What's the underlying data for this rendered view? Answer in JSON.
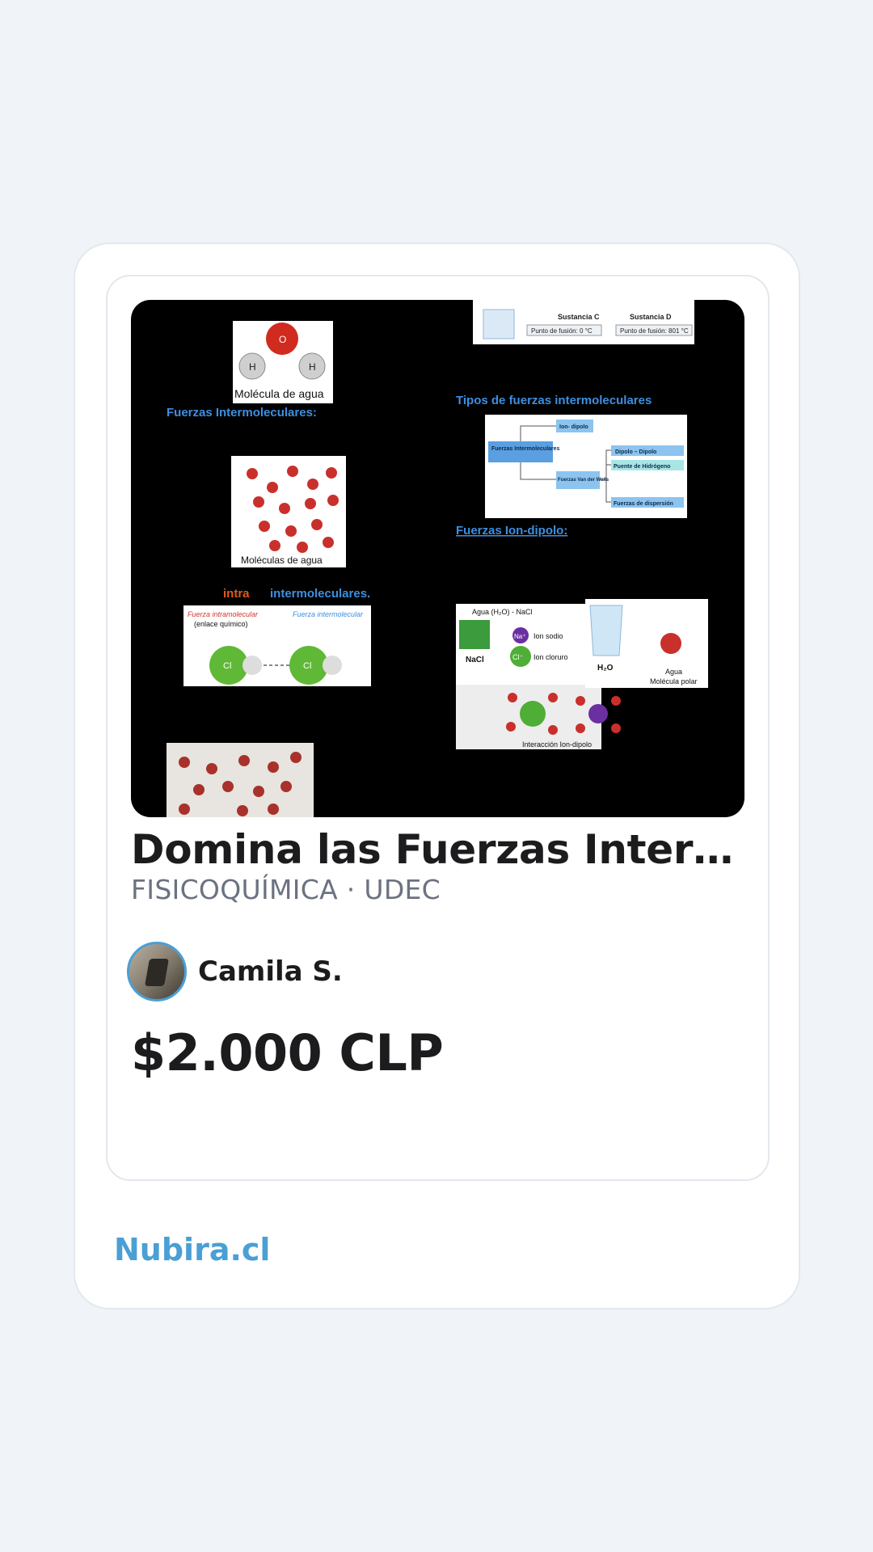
{
  "listing": {
    "title": "Domina las Fuerzas Intermol…",
    "subtitle": "FISICOQUÍMICA · UDEC",
    "author_name": "Camila S.",
    "price": "$2.000 CLP"
  },
  "footer": {
    "brand": "Nubira.cl"
  },
  "thumbnail": {
    "label_molecula_agua": "Molécula de agua",
    "label_fuerzas_inter": "Fuerzas Intermoleculares:",
    "label_moleculas_agua": "Moléculas de agua",
    "label_intra": "intra",
    "label_intermoleculares": "intermoleculares.",
    "label_fuerza_intra": "Fuerza intramolecular",
    "label_enlace": "(enlace químico)",
    "label_fuerza_inter": "Fuerza intermolecular",
    "label_sustancia_c": "Sustancia C",
    "label_sustancia_d": "Sustancia D",
    "label_fusion_c": "Punto de fusión: 0 °C",
    "label_fusion_d": "Punto de fusión: 801 °C",
    "label_tipos": "Tipos de fuerzas intermoleculares",
    "label_ion_dipolo_box": "Ion- dipolo",
    "label_fuerzas_box": "Fuerzas Intermoleculares",
    "label_dipolo_dipolo": "Dipolo – Dipolo",
    "label_puente": "Puente de Hidrógeno",
    "label_van_der_waals": "Fuerzas Van der Walls",
    "label_dispersion": "Fuerzas de dispersión",
    "label_fuerzas_ion_dipolo": "Fuerzas Ion-dipolo:",
    "label_agua_nacl": "Agua (H₂O) - NaCl",
    "label_nacl": "NaCl",
    "label_ion_sodio": "Ion sodio",
    "label_ion_cloruro": "Ion cloruro",
    "label_h2o": "H₂O",
    "label_agua": "Agua",
    "label_molecula_polar": "Molécula polar",
    "label_interaccion": "Interacción Ion-dipolo",
    "label_cl": "Cl",
    "label_h": "H",
    "label_o": "O",
    "label_na": "Na⁺",
    "label_cl_minus": "Cl⁻"
  },
  "colors": {
    "accent": "#4a9fd5",
    "title_text": "#1c1c1e",
    "subtitle_text": "#6b7280",
    "thumbnail_bg": "#000000",
    "slide_blue_text": "#3d8fe0",
    "slide_orange_text": "#e05a1c",
    "page_bg": "#f0f4f8"
  }
}
